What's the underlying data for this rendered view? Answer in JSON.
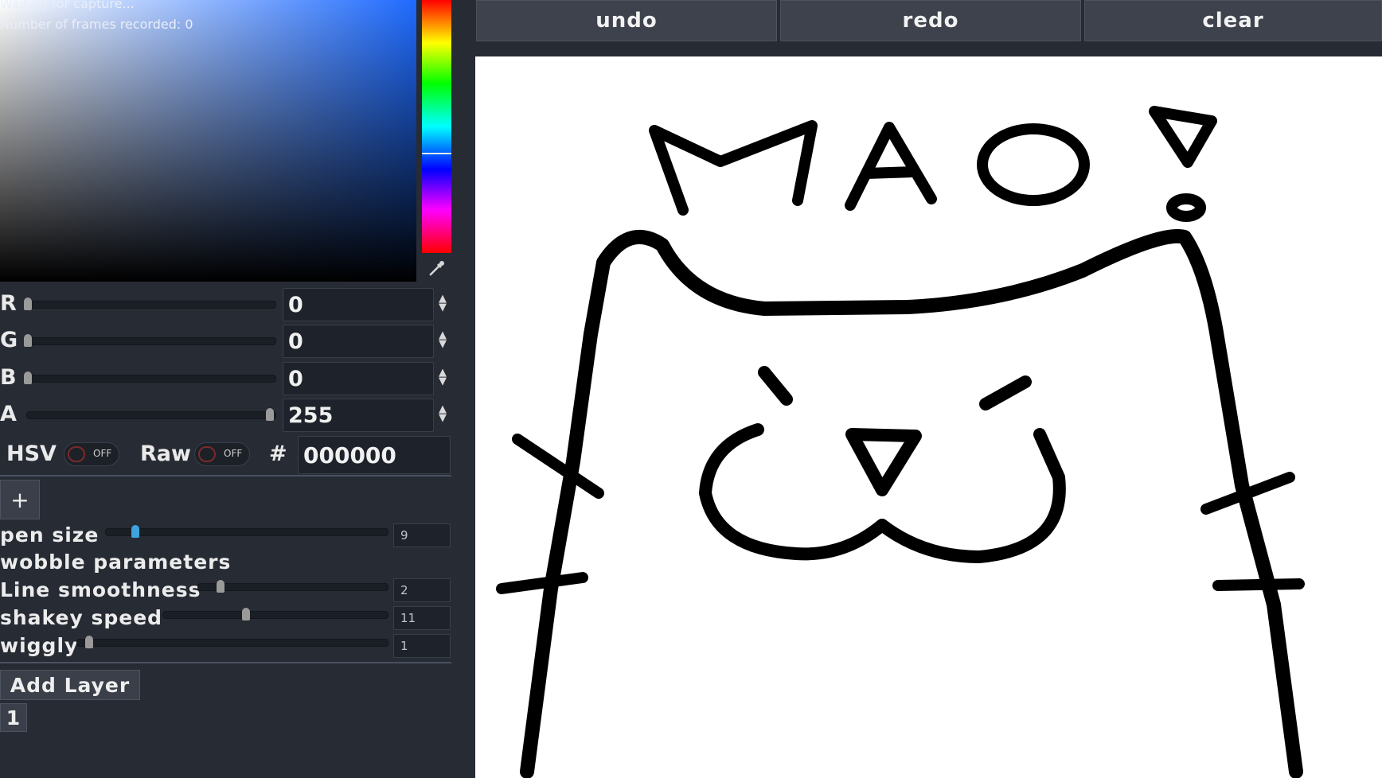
{
  "capture": {
    "status": "Waiting for capture...",
    "frames": "Number of frames recorded: 0"
  },
  "color": {
    "channels": [
      {
        "label": "R",
        "value": "0",
        "level": 0.0
      },
      {
        "label": "G",
        "value": "0",
        "level": 0.0
      },
      {
        "label": "B",
        "value": "0",
        "level": 0.0
      },
      {
        "label": "A",
        "value": "255",
        "level": 1.0
      }
    ],
    "hsv_label": "HSV",
    "hsv_toggle": "OFF",
    "raw_label": "Raw",
    "raw_toggle": "OFF",
    "hex_symbol": "#",
    "hex_value": "000000",
    "add_preset": "+"
  },
  "brush": {
    "pen_size_label": "pen size",
    "pen_size_value": "9",
    "wobble_title": "wobble parameters",
    "params": [
      {
        "label": "Line smoothness",
        "value": "2"
      },
      {
        "label": "shakey speed",
        "value": "11"
      },
      {
        "label": "wiggly",
        "value": "1"
      }
    ]
  },
  "layers": {
    "add_label": "Add Layer",
    "items": [
      "1"
    ]
  },
  "toolbar": {
    "undo": "undo",
    "redo": "redo",
    "clear": "clear"
  },
  "drawing": {
    "text": "MAO!"
  }
}
